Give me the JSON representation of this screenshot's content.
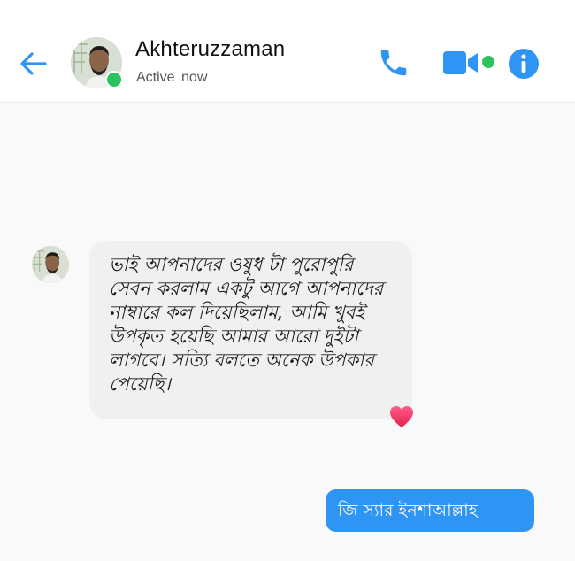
{
  "header": {
    "contact_name": "Akhteruzzaman",
    "status": "Active now",
    "icons": {
      "back": "arrow-left-icon",
      "call": "phone-icon",
      "video": "video-camera-icon",
      "info": "info-icon"
    }
  },
  "messages": [
    {
      "direction": "incoming",
      "text": "ভাই আপনাদের ওষুধ টা পুরোপুরি সেবন করলাম একটু আগে আপনাদের নাম্বারে কল দিয়েছিলাম, আমি খুবই উপকৃত হয়েছি আমার আরো দুইটা লাগবে। সত্যি বলতে অনেক উপকার পেয়েছি।",
      "reaction": "heart-icon"
    },
    {
      "direction": "outgoing",
      "text": "জি স্যার ইনশাআল্লাহ"
    }
  ],
  "colors": {
    "accent": "#2f95f5",
    "online": "#2ac35c",
    "incoming_bubble": "#f0f0f0",
    "reaction_heart": "#f0386b"
  }
}
